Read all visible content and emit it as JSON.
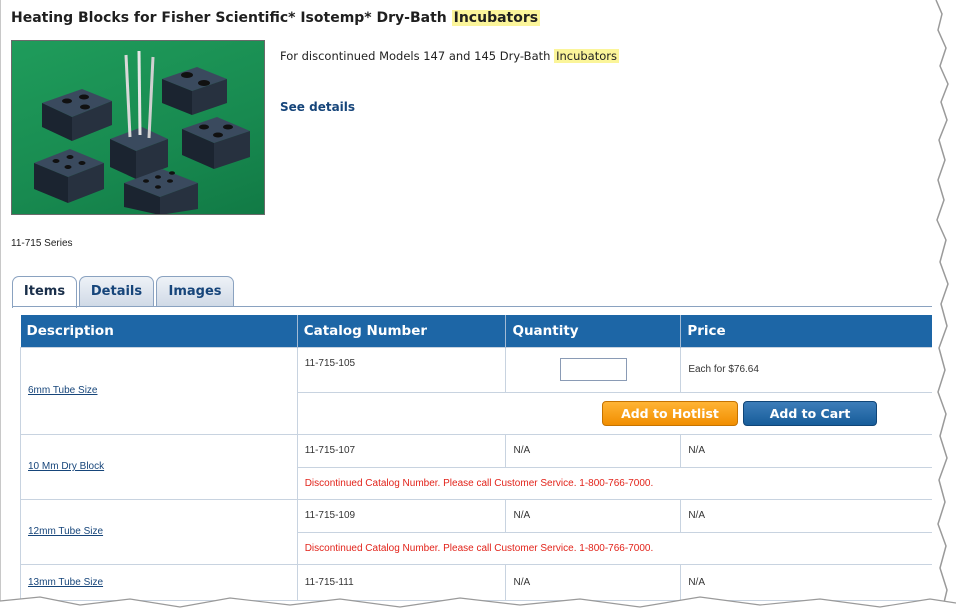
{
  "product": {
    "title_main": "Heating Blocks for Fisher Scientific* Isotemp* Dry-Bath",
    "title_highlight": "Incubators",
    "subtitle_main": "For discontinued Models 147 and 145 Dry-Bath",
    "subtitle_highlight": "Incubators",
    "see_details": "See details",
    "series": "11-715 Series"
  },
  "tabs": [
    {
      "label": "Items",
      "active": true
    },
    {
      "label": "Details",
      "active": false
    },
    {
      "label": "Images",
      "active": false
    }
  ],
  "table": {
    "headers": [
      "Description",
      "Catalog Number",
      "Quantity",
      "Price"
    ],
    "rows": [
      {
        "description": "6mm Tube Size",
        "catalog": "11-715-105",
        "quantity": "",
        "price": "Each for $76.64",
        "hotlist": "Add to Hotlist",
        "cart": "Add to Cart"
      },
      {
        "description": "10 Mm Dry Block",
        "catalog": "11-715-107",
        "quantity": "N/A",
        "price": "N/A",
        "note": "Discontinued Catalog Number. Please call Customer Service. 1-800-766-7000."
      },
      {
        "description": "12mm Tube Size",
        "catalog": "11-715-109",
        "quantity": "N/A",
        "price": "N/A",
        "note": "Discontinued Catalog Number. Please call Customer Service. 1-800-766-7000."
      },
      {
        "description": "13mm Tube Size",
        "catalog": "11-715-111",
        "quantity": "N/A",
        "price": "N/A"
      }
    ]
  },
  "colors": {
    "header_blue": "#1d66a6",
    "link_blue": "#16457a",
    "highlight": "#fbf59a",
    "hotlist_orange": "#f18e00",
    "discontinued_red": "#e2231a"
  }
}
